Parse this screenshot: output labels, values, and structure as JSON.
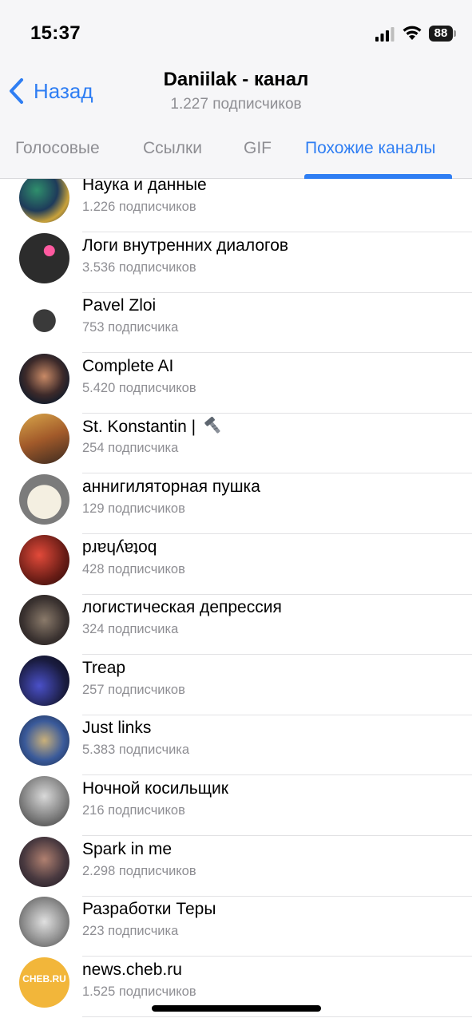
{
  "status": {
    "time": "15:37",
    "battery": "88"
  },
  "nav": {
    "back_label": "Назад",
    "title": "Daniilak - канал",
    "subtitle": "1.227 подписчиков"
  },
  "tabs": [
    "Голосовые",
    "Ссылки",
    "GIF",
    "Похожие каналы"
  ],
  "active_tab": "Похожие каналы",
  "accent_color": "#2f7ef3",
  "channels": [
    {
      "name": "Наука и данные",
      "subs": "1.226 подписчиков"
    },
    {
      "name": "Логи внутренних диалогов",
      "subs": "3.536 подписчиков"
    },
    {
      "name": "Pavel Zloi",
      "subs": "753 подписчика"
    },
    {
      "name": "Complete AI",
      "subs": "5.420 подписчиков"
    },
    {
      "name": "St. Konstantin |",
      "subs": "254 подписчика",
      "icon": "bolt-icon"
    },
    {
      "name": "аннигиляторная пушка",
      "subs": "129 подписчиков"
    },
    {
      "name": "botayhard",
      "subs": "428 подписчиков",
      "flipped": true
    },
    {
      "name": "логистическая депрессия",
      "subs": "324 подписчика"
    },
    {
      "name": "Treap",
      "subs": "257 подписчиков"
    },
    {
      "name": "Just links",
      "subs": "5.383 подписчика"
    },
    {
      "name": "Ночной косильщик",
      "subs": "216 подписчиков"
    },
    {
      "name": "Spark in me",
      "subs": "2.298 подписчиков"
    },
    {
      "name": "Разработки Теры",
      "subs": "223 подписчика"
    },
    {
      "name": "news.cheb.ru",
      "subs": "1.525 подписчиков",
      "avatar_text": "CHEB.RU"
    }
  ]
}
